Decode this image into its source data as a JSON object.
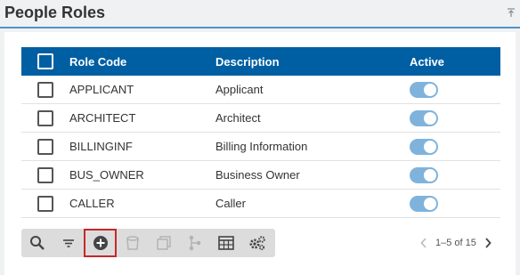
{
  "page": {
    "title": "People Roles"
  },
  "table": {
    "headers": {
      "role_code": "Role Code",
      "description": "Description",
      "active": "Active"
    },
    "rows": [
      {
        "role_code": "APPLICANT",
        "description": "Applicant",
        "active": true
      },
      {
        "role_code": "ARCHITECT",
        "description": "Architect",
        "active": true
      },
      {
        "role_code": "BILLINGINF",
        "description": "Billing Information",
        "active": true
      },
      {
        "role_code": "BUS_OWNER",
        "description": "Business Owner",
        "active": true
      },
      {
        "role_code": "CALLER",
        "description": "Caller",
        "active": true
      }
    ]
  },
  "toolbar": {
    "buttons": [
      {
        "icon": "search-icon",
        "enabled": true
      },
      {
        "icon": "filter-icon",
        "enabled": true
      },
      {
        "icon": "add-icon",
        "enabled": true,
        "selected": true
      },
      {
        "icon": "delete-icon",
        "enabled": false
      },
      {
        "icon": "copy-icon",
        "enabled": false
      },
      {
        "icon": "hierarchy-icon",
        "enabled": false
      },
      {
        "icon": "grid-icon",
        "enabled": true
      },
      {
        "icon": "settings-icon",
        "enabled": true
      }
    ]
  },
  "pager": {
    "range_text": "1–5 of 15"
  },
  "colors": {
    "header_bg": "#005fa3",
    "accent": "#4d94c9",
    "toggle_on": "#7fb3dc",
    "selected_border": "#c62828"
  }
}
